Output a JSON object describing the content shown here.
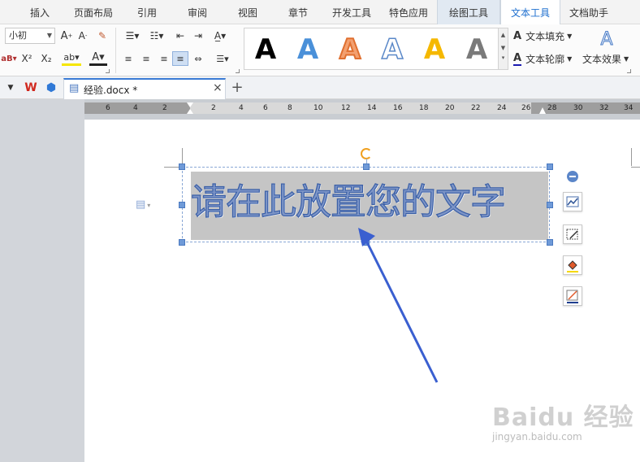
{
  "menu": {
    "tabs": [
      {
        "label": "插入"
      },
      {
        "label": "页面布局"
      },
      {
        "label": "引用"
      },
      {
        "label": "审阅"
      },
      {
        "label": "视图"
      },
      {
        "label": "章节"
      },
      {
        "label": "开发工具"
      },
      {
        "label": "特色应用"
      },
      {
        "label": "绘图工具"
      },
      {
        "label": "文本工具"
      },
      {
        "label": "文档助手"
      }
    ],
    "active_tab": "文本工具",
    "graphic_tab": "绘图工具"
  },
  "ribbon": {
    "font_size": "小初",
    "text_fill_label": "文本填充",
    "text_outline_label": "文本轮廓",
    "text_effect_label": "文本效果",
    "style_gallery": [
      "A",
      "A",
      "A",
      "A",
      "A",
      "A"
    ],
    "accent_color": "#1e6fcf"
  },
  "tabbar": {
    "doc_tab_label": "经验.docx *",
    "close_glyph": "×",
    "new_tab_glyph": "+"
  },
  "ruler": {
    "labels": [
      "6",
      "4",
      "2",
      "2",
      "4",
      "6",
      "8",
      "10",
      "12",
      "14",
      "16",
      "18",
      "20",
      "22",
      "24",
      "26",
      "28",
      "30",
      "32",
      "34"
    ]
  },
  "document": {
    "textbox_text": "请在此放置您的文字"
  },
  "watermark": {
    "logo_text": "Baidu 经验",
    "url_text": "jingyan.baidu.com"
  }
}
